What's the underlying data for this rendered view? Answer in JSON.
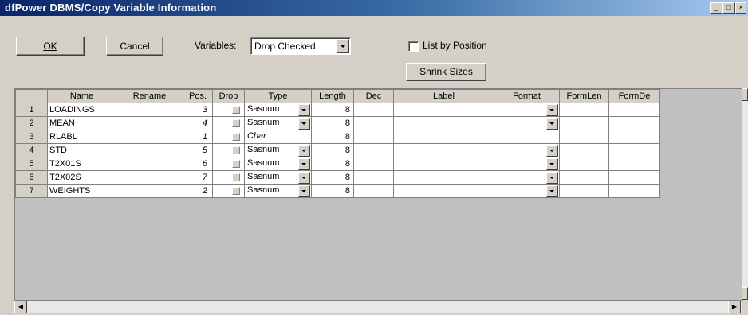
{
  "window": {
    "title": "dfPower DBMS/Copy Variable Information"
  },
  "toolbar": {
    "ok_label": "OK",
    "cancel_label": "Cancel",
    "variables_label": "Variables:",
    "variables_value": "Drop Checked",
    "list_by_position_label": "List by Position",
    "list_by_position_checked": false,
    "shrink_sizes_label": "Shrink Sizes"
  },
  "table": {
    "columns": [
      "",
      "Name",
      "Rename",
      "Pos.",
      "Drop",
      "Type",
      "Length",
      "Dec",
      "Label",
      "Format",
      "FormLen",
      "FormDe"
    ],
    "rows": [
      {
        "num": "1",
        "name": "LOADINGS",
        "rename": "",
        "pos": "3",
        "drop": false,
        "type": "Sasnum",
        "type_dropdown": true,
        "length": "8",
        "dec": "",
        "label": "",
        "format": "",
        "format_dropdown": true,
        "formlen": "",
        "formde": ""
      },
      {
        "num": "2",
        "name": "MEAN",
        "rename": "",
        "pos": "4",
        "drop": false,
        "type": "Sasnum",
        "type_dropdown": true,
        "length": "8",
        "dec": "",
        "label": "",
        "format": "",
        "format_dropdown": true,
        "formlen": "",
        "formde": ""
      },
      {
        "num": "3",
        "name": "RLABL",
        "rename": "",
        "pos": "1",
        "drop": false,
        "type": "Char",
        "type_dropdown": false,
        "length": "8",
        "dec": "",
        "label": "",
        "format": "",
        "format_dropdown": false,
        "formlen": "",
        "formde": ""
      },
      {
        "num": "4",
        "name": "STD",
        "rename": "",
        "pos": "5",
        "drop": false,
        "type": "Sasnum",
        "type_dropdown": true,
        "length": "8",
        "dec": "",
        "label": "",
        "format": "",
        "format_dropdown": true,
        "formlen": "",
        "formde": ""
      },
      {
        "num": "5",
        "name": "T2X01S",
        "rename": "",
        "pos": "6",
        "drop": false,
        "type": "Sasnum",
        "type_dropdown": true,
        "length": "8",
        "dec": "",
        "label": "",
        "format": "",
        "format_dropdown": true,
        "formlen": "",
        "formde": ""
      },
      {
        "num": "6",
        "name": "T2X02S",
        "rename": "",
        "pos": "7",
        "drop": false,
        "type": "Sasnum",
        "type_dropdown": true,
        "length": "8",
        "dec": "",
        "label": "",
        "format": "",
        "format_dropdown": true,
        "formlen": "",
        "formde": ""
      },
      {
        "num": "7",
        "name": "WEIGHTS",
        "rename": "",
        "pos": "2",
        "drop": false,
        "type": "Sasnum",
        "type_dropdown": true,
        "length": "8",
        "dec": "",
        "label": "",
        "format": "",
        "format_dropdown": true,
        "formlen": "",
        "formde": ""
      }
    ]
  },
  "icons": {
    "minimize": "minimize-icon",
    "maximize": "maximize-icon",
    "close": "close-icon",
    "scroll_left": "scroll-left-icon",
    "scroll_right": "scroll-right-icon",
    "scroll_up": "scroll-up-icon",
    "scroll_down": "scroll-down-icon"
  }
}
